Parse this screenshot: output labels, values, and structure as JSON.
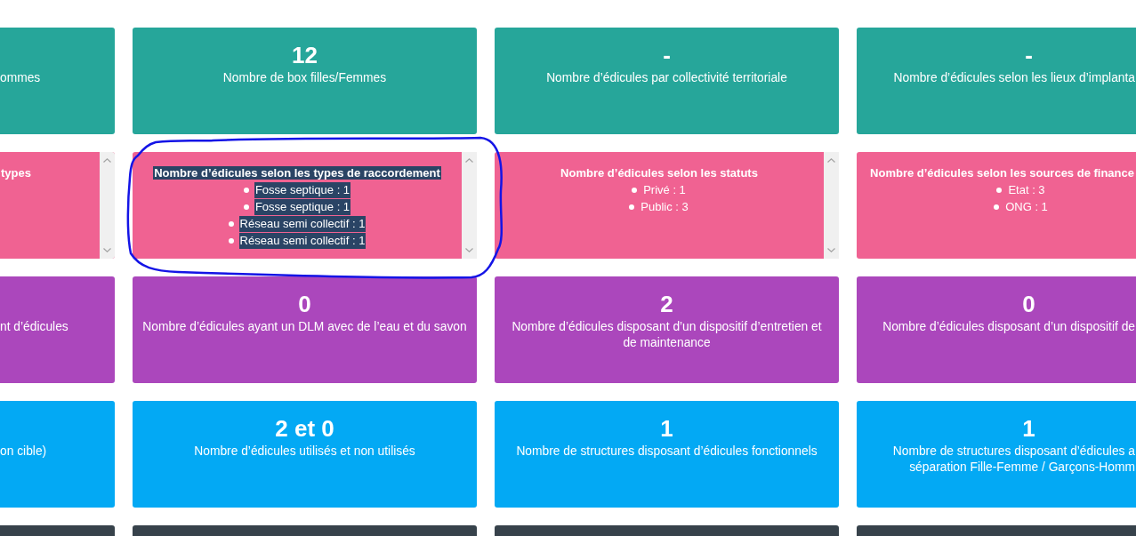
{
  "rows": [
    {
      "color": "#26a69a",
      "cards": [
        {
          "kind": "stat",
          "label": "ommes",
          "circled": false
        },
        {
          "kind": "stat",
          "value": "12",
          "label": "Nombre de box filles/Femmes",
          "circled": false
        },
        {
          "kind": "stat",
          "value": "-",
          "label": "Nombre d’édicules par collectivité territoriale",
          "circled": false
        },
        {
          "kind": "stat",
          "value": "-",
          "label": "Nombre d’édicules selon les lieux d’implanta",
          "circled": false
        }
      ]
    },
    {
      "color": "#f06292",
      "cards": [
        {
          "kind": "list",
          "title": "types",
          "scrollbar": true,
          "text_selected": false,
          "circled": false
        },
        {
          "kind": "list",
          "title": "Nombre d’édicules selon les types de raccordement",
          "items": [
            "Fosse septique : 1",
            "Fosse septique : 1",
            "Réseau semi collectif : 1",
            "Réseau semi collectif : 1"
          ],
          "scrollbar": true,
          "text_selected": true,
          "circled": true
        },
        {
          "kind": "list",
          "title": "Nombre d’édicules selon les statuts",
          "items": [
            "Privé : 1",
            "Public : 3"
          ],
          "scrollbar": true,
          "text_selected": false,
          "circled": false
        },
        {
          "kind": "list",
          "title": "Nombre d’édicules selon les sources de finance",
          "items": [
            "Etat : 3",
            "ONG : 1"
          ],
          "scrollbar": false,
          "text_selected": false,
          "circled": false
        }
      ]
    },
    {
      "color": "#ab47bc",
      "cards": [
        {
          "kind": "stat",
          "label": "nt d’édicules",
          "circled": false
        },
        {
          "kind": "stat",
          "value": "0",
          "label": "Nombre d’édicules ayant un DLM avec de l’eau et du savon",
          "circled": false
        },
        {
          "kind": "stat",
          "value": "2",
          "label": "Nombre d’édicules disposant d’un dispositif d’entretien et\nde maintenance",
          "circled": false
        },
        {
          "kind": "stat",
          "value": "0",
          "label": "Nombre d’édicules disposant d’un dispositif de",
          "circled": false
        }
      ]
    },
    {
      "color": "#03a9f4",
      "cards": [
        {
          "kind": "stat",
          "label": "on cible)",
          "circled": false
        },
        {
          "kind": "stat",
          "value": "2 et 0",
          "label": "Nombre d’édicules utilisés et non utilisés",
          "circled": false
        },
        {
          "kind": "stat",
          "value": "1",
          "label": "Nombre de structures disposant d’édicules fonctionnels",
          "circled": false
        },
        {
          "kind": "stat",
          "value": "1",
          "label": "Nombre de structures disposant d’édicules a\nséparation Fille-Femme / Garçons-Homm",
          "circled": false
        }
      ]
    },
    {
      "color": "#37424b",
      "cards": [
        {
          "kind": "stat",
          "circled": false
        },
        {
          "kind": "stat",
          "circled": false
        },
        {
          "kind": "stat",
          "circled": false
        },
        {
          "kind": "stat",
          "circled": false
        }
      ]
    }
  ]
}
